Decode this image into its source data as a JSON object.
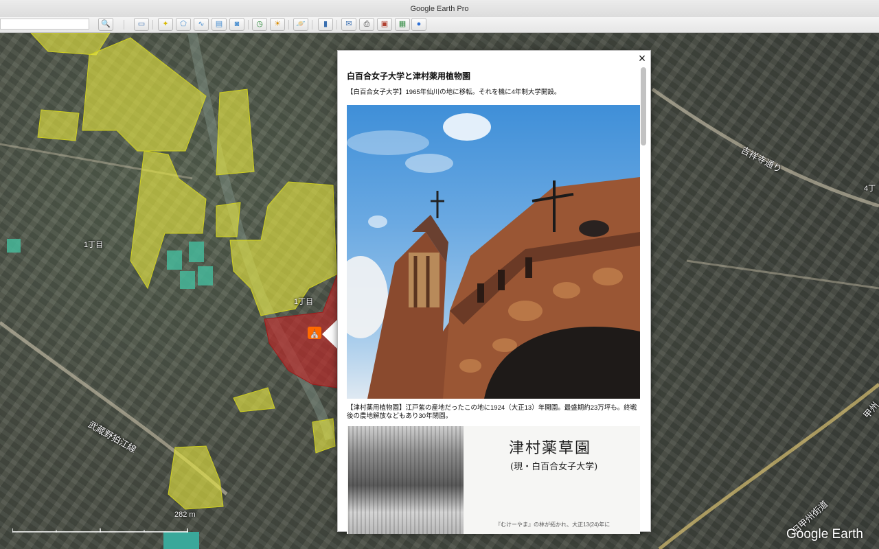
{
  "window": {
    "title": "Google Earth Pro"
  },
  "toolbar": {
    "search_value": "",
    "buttons": [
      {
        "name": "search-icon",
        "glyph": "🔍"
      },
      {
        "name": "sidebar-toggle-icon",
        "glyph": "▭"
      },
      {
        "name": "placemark-icon",
        "glyph": "📌"
      },
      {
        "name": "polygon-icon",
        "glyph": "⬠"
      },
      {
        "name": "path-icon",
        "glyph": "〰"
      },
      {
        "name": "image-overlay-icon",
        "glyph": "🖼"
      },
      {
        "name": "record-tour-icon",
        "glyph": "🎥"
      },
      {
        "name": "historical-imagery-icon",
        "glyph": "🕒"
      },
      {
        "name": "sunlight-icon",
        "glyph": "⛰"
      },
      {
        "name": "planets-icon",
        "glyph": "🪐"
      },
      {
        "name": "ruler-icon",
        "glyph": "📏"
      },
      {
        "name": "email-icon",
        "glyph": "✉"
      },
      {
        "name": "print-icon",
        "glyph": "🖶"
      },
      {
        "name": "save-image-icon",
        "glyph": "💾"
      },
      {
        "name": "view-in-maps-icon",
        "glyph": "🗺"
      },
      {
        "name": "earth-globe-icon",
        "glyph": "●"
      }
    ]
  },
  "map": {
    "labels": {
      "district_1": "1丁目",
      "district_2": "1丁目",
      "district_3": "4丁",
      "road_1": "武蔵野狛江線",
      "road_2": "吉祥寺通り",
      "road_3": "旧甲州街道",
      "road_4": "甲州"
    },
    "scale_label": "282 m",
    "logo": "Google Earth"
  },
  "balloon": {
    "close_label": "×",
    "title": "白百合女子大学と津村薬用植物園",
    "para1": "【白百合女子大学】1965年仙川の地に移転。それを機に4年制大学開設。",
    "para2": "【津村薬用植物園】江戸紫の産地だったこの地に1924（大正13）年開園。最盛期約23万坪も。終戦後の農地解放などもあり30年閉園。",
    "old_photo_title": "津村薬草園",
    "old_photo_subtitle": "(現・白百合女子大学)",
    "old_photo_caption": "『むけーやま』の林が拓かれ、大正13(24)年に"
  }
}
